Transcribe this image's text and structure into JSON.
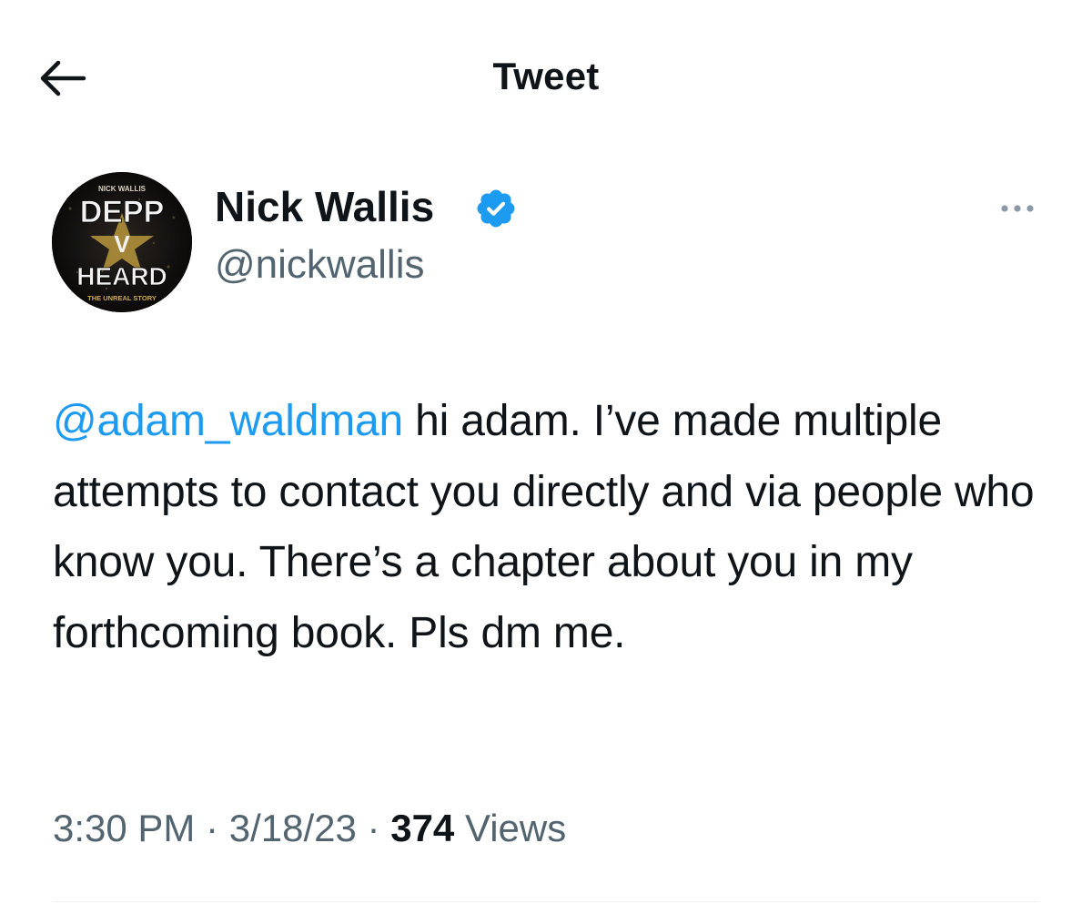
{
  "header": {
    "title": "Tweet",
    "back_icon": "arrow-left-icon"
  },
  "author": {
    "display_name": "Nick Wallis",
    "handle": "@nickwallis",
    "verified_icon": "verified-badge-icon",
    "verified_color": "#1d9bf0",
    "avatar": {
      "top_text": "NICK WALLIS",
      "line1": "DEPP",
      "line2": "V",
      "line3": "HEARD",
      "bottom_text": "THE UNREAL STORY"
    }
  },
  "more_icon": "more-horizontal-icon",
  "tweet": {
    "mention": "@adam_waldman",
    "body": " hi adam. I’ve made multiple attempts to contact you directly and via people who know you. There’s a chapter about you in my forthcoming book. Pls dm me."
  },
  "meta": {
    "time": "3:30 PM",
    "separator": " · ",
    "date": "3/18/23",
    "view_count": "374",
    "views_label": " Views"
  },
  "colors": {
    "text": "#0f1419",
    "secondary": "#536471",
    "accent": "#1d9bf0"
  }
}
